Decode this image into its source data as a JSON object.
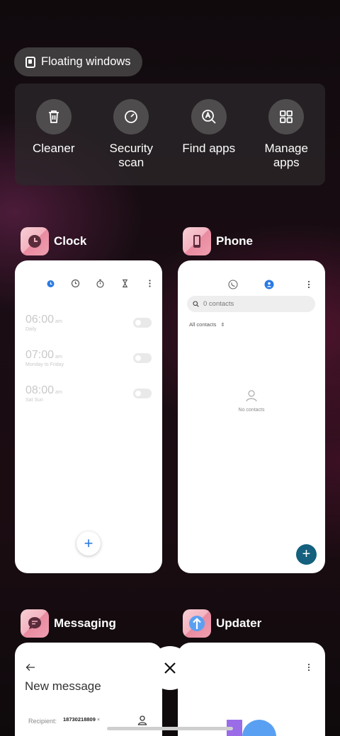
{
  "floating_windows": {
    "label": "Floating windows"
  },
  "tools": [
    {
      "label": "Cleaner",
      "icon": "trash-icon"
    },
    {
      "label": "Security\nscan",
      "icon": "security-scan-icon"
    },
    {
      "label": "Find apps",
      "icon": "find-apps-icon"
    },
    {
      "label": "Manage\napps",
      "icon": "grid-icon"
    }
  ],
  "apps": {
    "clock": {
      "name": "Clock",
      "alarms": [
        {
          "time": "06:00",
          "ampm": "am",
          "repeat": "Daily"
        },
        {
          "time": "07:00",
          "ampm": "am",
          "repeat": "Monday to Friday"
        },
        {
          "time": "08:00",
          "ampm": "am",
          "repeat": "Sat Sun"
        }
      ],
      "fab": "+"
    },
    "phone": {
      "name": "Phone",
      "search_placeholder": "0 contacts",
      "filter": "All contacts",
      "empty": "No contacts",
      "fab": "+"
    },
    "messaging": {
      "name": "Messaging",
      "title": "New message",
      "recipient_label": "Recipient:",
      "recipient": "18730218809"
    },
    "updater": {
      "name": "Updater"
    }
  },
  "colors": {
    "accent_blue": "#2a7ae2",
    "fab_teal": "#14607e",
    "updater_blue": "#5aa0f2",
    "updater_purple": "#9a6ce8"
  }
}
